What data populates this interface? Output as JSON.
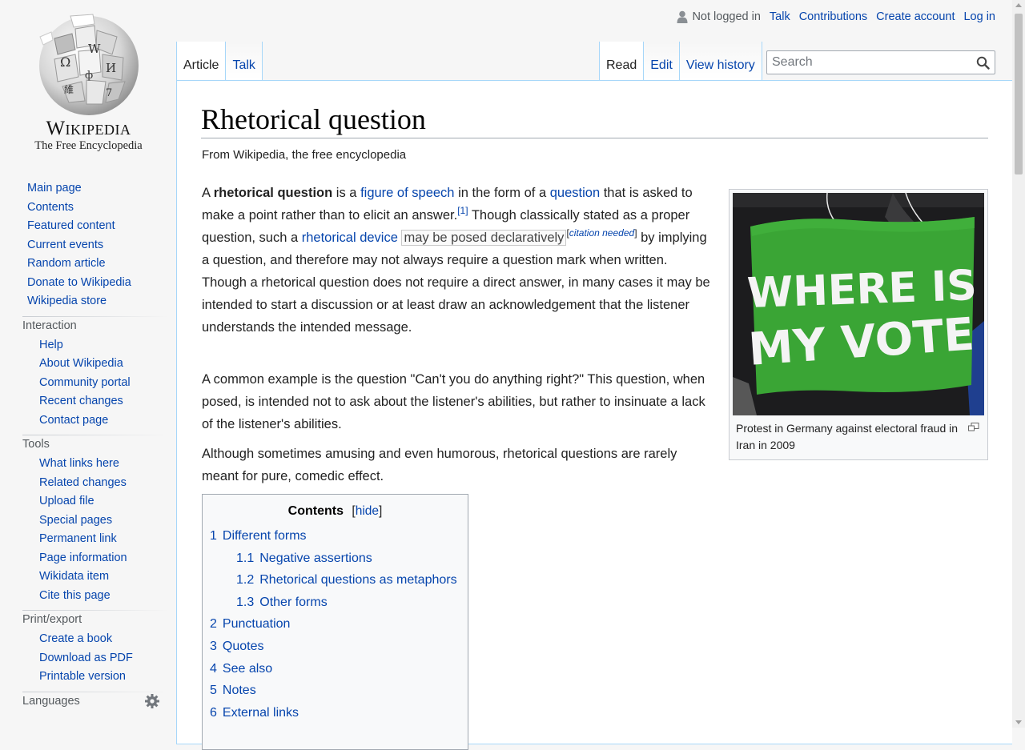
{
  "personal": {
    "not_logged_in": "Not logged in",
    "talk": "Talk",
    "contributions": "Contributions",
    "create_account": "Create account",
    "log_in": "Log in"
  },
  "logo": {
    "wordmark": "Wikipedia",
    "tagline": "The Free Encyclopedia"
  },
  "tabs": {
    "article": "Article",
    "talk": "Talk",
    "read": "Read",
    "edit": "Edit",
    "view_history": "View history"
  },
  "search": {
    "placeholder": "Search"
  },
  "sidebar": {
    "navigation": [
      "Main page",
      "Contents",
      "Featured content",
      "Current events",
      "Random article",
      "Donate to Wikipedia",
      "Wikipedia store"
    ],
    "interaction": {
      "heading": "Interaction",
      "items": [
        "Help",
        "About Wikipedia",
        "Community portal",
        "Recent changes",
        "Contact page"
      ]
    },
    "tools": {
      "heading": "Tools",
      "items": [
        "What links here",
        "Related changes",
        "Upload file",
        "Special pages",
        "Permanent link",
        "Page information",
        "Wikidata item",
        "Cite this page"
      ]
    },
    "print": {
      "heading": "Print/export",
      "items": [
        "Create a book",
        "Download as PDF",
        "Printable version"
      ]
    },
    "languages": {
      "heading": "Languages"
    }
  },
  "article": {
    "title": "Rhetorical question",
    "site_sub": "From Wikipedia, the free encyclopedia",
    "p1": {
      "t1": "A ",
      "bold": "rhetorical question",
      "t2": " is a ",
      "link_figure": "figure of speech",
      "t3": " in the form of a ",
      "link_question": "question",
      "t4": " that is asked to make a point rather than to elicit an answer.",
      "ref1": "[1]",
      "t5": " Though classically stated as a proper question, such a ",
      "link_device": "rhetorical device",
      "t6": " ",
      "dotted": "may be posed declaratively",
      "cn_open": "[",
      "cn": "citation needed",
      "cn_close": "]",
      "t7": " by implying a question, and therefore may not always require a question mark when written. Though a rhetorical question does not require a direct answer, in many cases it may be intended to start a discussion or at least draw an acknowledgement that the listener understands the intended message."
    },
    "p2": "A common example is the question \"Can't you do anything right?\" This question, when posed, is intended not to ask about the listener's abilities, but rather to insinuate a lack of the listener's abilities.",
    "p3": "Although sometimes amusing and even humorous, rhetorical questions are rarely meant for pure, comedic effect.",
    "image": {
      "sign_line1": "WHERE IS",
      "sign_line2": "MY VOTE",
      "caption": "Protest in Germany against electoral fraud in Iran in 2009"
    }
  },
  "toc": {
    "title": "Contents",
    "hide_open": "[",
    "hide": "hide",
    "hide_close": "]",
    "items": [
      {
        "num": "1",
        "text": "Different forms",
        "level": 1
      },
      {
        "num": "1.1",
        "text": "Negative assertions",
        "level": 2
      },
      {
        "num": "1.2",
        "text": "Rhetorical questions as metaphors",
        "level": 2
      },
      {
        "num": "1.3",
        "text": "Other forms",
        "level": 2
      },
      {
        "num": "2",
        "text": "Punctuation",
        "level": 1
      },
      {
        "num": "3",
        "text": "Quotes",
        "level": 1
      },
      {
        "num": "4",
        "text": "See also",
        "level": 1
      },
      {
        "num": "5",
        "text": "Notes",
        "level": 1
      },
      {
        "num": "6",
        "text": "External links",
        "level": 1
      }
    ]
  }
}
